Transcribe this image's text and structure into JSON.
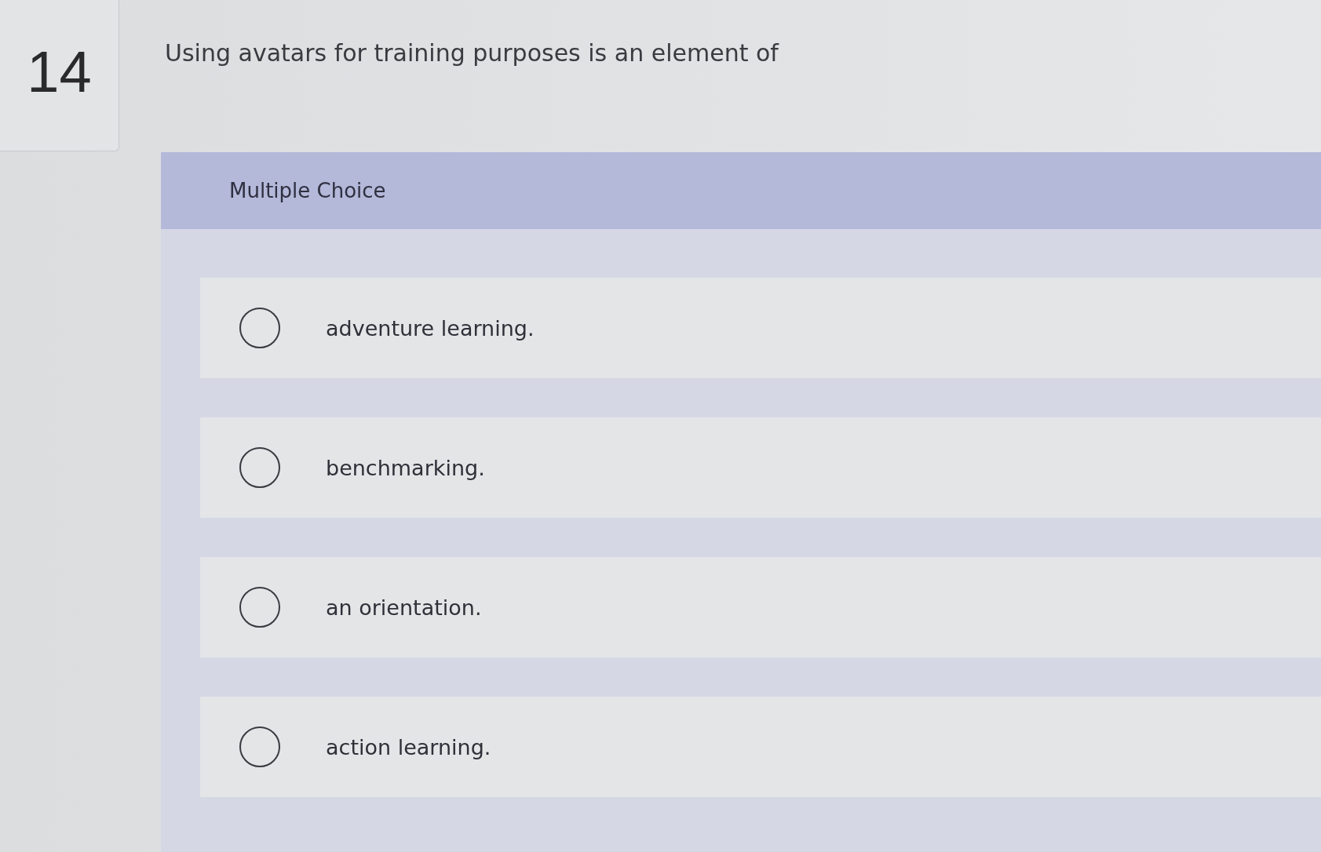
{
  "question": {
    "number": "14",
    "text": "Using avatars for training purposes is an element of"
  },
  "answer_panel": {
    "heading": "Multiple Choice",
    "options": [
      {
        "label": "adventure learning.",
        "selected": false
      },
      {
        "label": "benchmarking.",
        "selected": false
      },
      {
        "label": "an orientation.",
        "selected": false
      },
      {
        "label": "action learning.",
        "selected": false
      }
    ]
  }
}
